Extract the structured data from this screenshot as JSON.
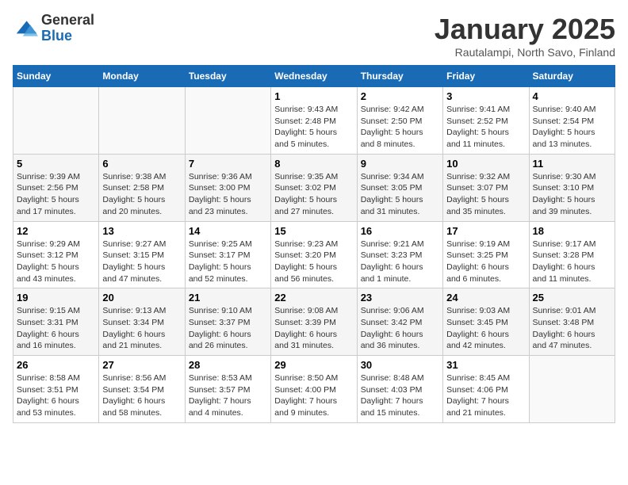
{
  "logo": {
    "general": "General",
    "blue": "Blue"
  },
  "title": "January 2025",
  "subtitle": "Rautalampi, North Savo, Finland",
  "days_of_week": [
    "Sunday",
    "Monday",
    "Tuesday",
    "Wednesday",
    "Thursday",
    "Friday",
    "Saturday"
  ],
  "weeks": [
    [
      {
        "day": "",
        "text": ""
      },
      {
        "day": "",
        "text": ""
      },
      {
        "day": "",
        "text": ""
      },
      {
        "day": "1",
        "text": "Sunrise: 9:43 AM\nSunset: 2:48 PM\nDaylight: 5 hours\nand 5 minutes."
      },
      {
        "day": "2",
        "text": "Sunrise: 9:42 AM\nSunset: 2:50 PM\nDaylight: 5 hours\nand 8 minutes."
      },
      {
        "day": "3",
        "text": "Sunrise: 9:41 AM\nSunset: 2:52 PM\nDaylight: 5 hours\nand 11 minutes."
      },
      {
        "day": "4",
        "text": "Sunrise: 9:40 AM\nSunset: 2:54 PM\nDaylight: 5 hours\nand 13 minutes."
      }
    ],
    [
      {
        "day": "5",
        "text": "Sunrise: 9:39 AM\nSunset: 2:56 PM\nDaylight: 5 hours\nand 17 minutes."
      },
      {
        "day": "6",
        "text": "Sunrise: 9:38 AM\nSunset: 2:58 PM\nDaylight: 5 hours\nand 20 minutes."
      },
      {
        "day": "7",
        "text": "Sunrise: 9:36 AM\nSunset: 3:00 PM\nDaylight: 5 hours\nand 23 minutes."
      },
      {
        "day": "8",
        "text": "Sunrise: 9:35 AM\nSunset: 3:02 PM\nDaylight: 5 hours\nand 27 minutes."
      },
      {
        "day": "9",
        "text": "Sunrise: 9:34 AM\nSunset: 3:05 PM\nDaylight: 5 hours\nand 31 minutes."
      },
      {
        "day": "10",
        "text": "Sunrise: 9:32 AM\nSunset: 3:07 PM\nDaylight: 5 hours\nand 35 minutes."
      },
      {
        "day": "11",
        "text": "Sunrise: 9:30 AM\nSunset: 3:10 PM\nDaylight: 5 hours\nand 39 minutes."
      }
    ],
    [
      {
        "day": "12",
        "text": "Sunrise: 9:29 AM\nSunset: 3:12 PM\nDaylight: 5 hours\nand 43 minutes."
      },
      {
        "day": "13",
        "text": "Sunrise: 9:27 AM\nSunset: 3:15 PM\nDaylight: 5 hours\nand 47 minutes."
      },
      {
        "day": "14",
        "text": "Sunrise: 9:25 AM\nSunset: 3:17 PM\nDaylight: 5 hours\nand 52 minutes."
      },
      {
        "day": "15",
        "text": "Sunrise: 9:23 AM\nSunset: 3:20 PM\nDaylight: 5 hours\nand 56 minutes."
      },
      {
        "day": "16",
        "text": "Sunrise: 9:21 AM\nSunset: 3:23 PM\nDaylight: 6 hours\nand 1 minute."
      },
      {
        "day": "17",
        "text": "Sunrise: 9:19 AM\nSunset: 3:25 PM\nDaylight: 6 hours\nand 6 minutes."
      },
      {
        "day": "18",
        "text": "Sunrise: 9:17 AM\nSunset: 3:28 PM\nDaylight: 6 hours\nand 11 minutes."
      }
    ],
    [
      {
        "day": "19",
        "text": "Sunrise: 9:15 AM\nSunset: 3:31 PM\nDaylight: 6 hours\nand 16 minutes."
      },
      {
        "day": "20",
        "text": "Sunrise: 9:13 AM\nSunset: 3:34 PM\nDaylight: 6 hours\nand 21 minutes."
      },
      {
        "day": "21",
        "text": "Sunrise: 9:10 AM\nSunset: 3:37 PM\nDaylight: 6 hours\nand 26 minutes."
      },
      {
        "day": "22",
        "text": "Sunrise: 9:08 AM\nSunset: 3:39 PM\nDaylight: 6 hours\nand 31 minutes."
      },
      {
        "day": "23",
        "text": "Sunrise: 9:06 AM\nSunset: 3:42 PM\nDaylight: 6 hours\nand 36 minutes."
      },
      {
        "day": "24",
        "text": "Sunrise: 9:03 AM\nSunset: 3:45 PM\nDaylight: 6 hours\nand 42 minutes."
      },
      {
        "day": "25",
        "text": "Sunrise: 9:01 AM\nSunset: 3:48 PM\nDaylight: 6 hours\nand 47 minutes."
      }
    ],
    [
      {
        "day": "26",
        "text": "Sunrise: 8:58 AM\nSunset: 3:51 PM\nDaylight: 6 hours\nand 53 minutes."
      },
      {
        "day": "27",
        "text": "Sunrise: 8:56 AM\nSunset: 3:54 PM\nDaylight: 6 hours\nand 58 minutes."
      },
      {
        "day": "28",
        "text": "Sunrise: 8:53 AM\nSunset: 3:57 PM\nDaylight: 7 hours\nand 4 minutes."
      },
      {
        "day": "29",
        "text": "Sunrise: 8:50 AM\nSunset: 4:00 PM\nDaylight: 7 hours\nand 9 minutes."
      },
      {
        "day": "30",
        "text": "Sunrise: 8:48 AM\nSunset: 4:03 PM\nDaylight: 7 hours\nand 15 minutes."
      },
      {
        "day": "31",
        "text": "Sunrise: 8:45 AM\nSunset: 4:06 PM\nDaylight: 7 hours\nand 21 minutes."
      },
      {
        "day": "",
        "text": ""
      }
    ]
  ]
}
